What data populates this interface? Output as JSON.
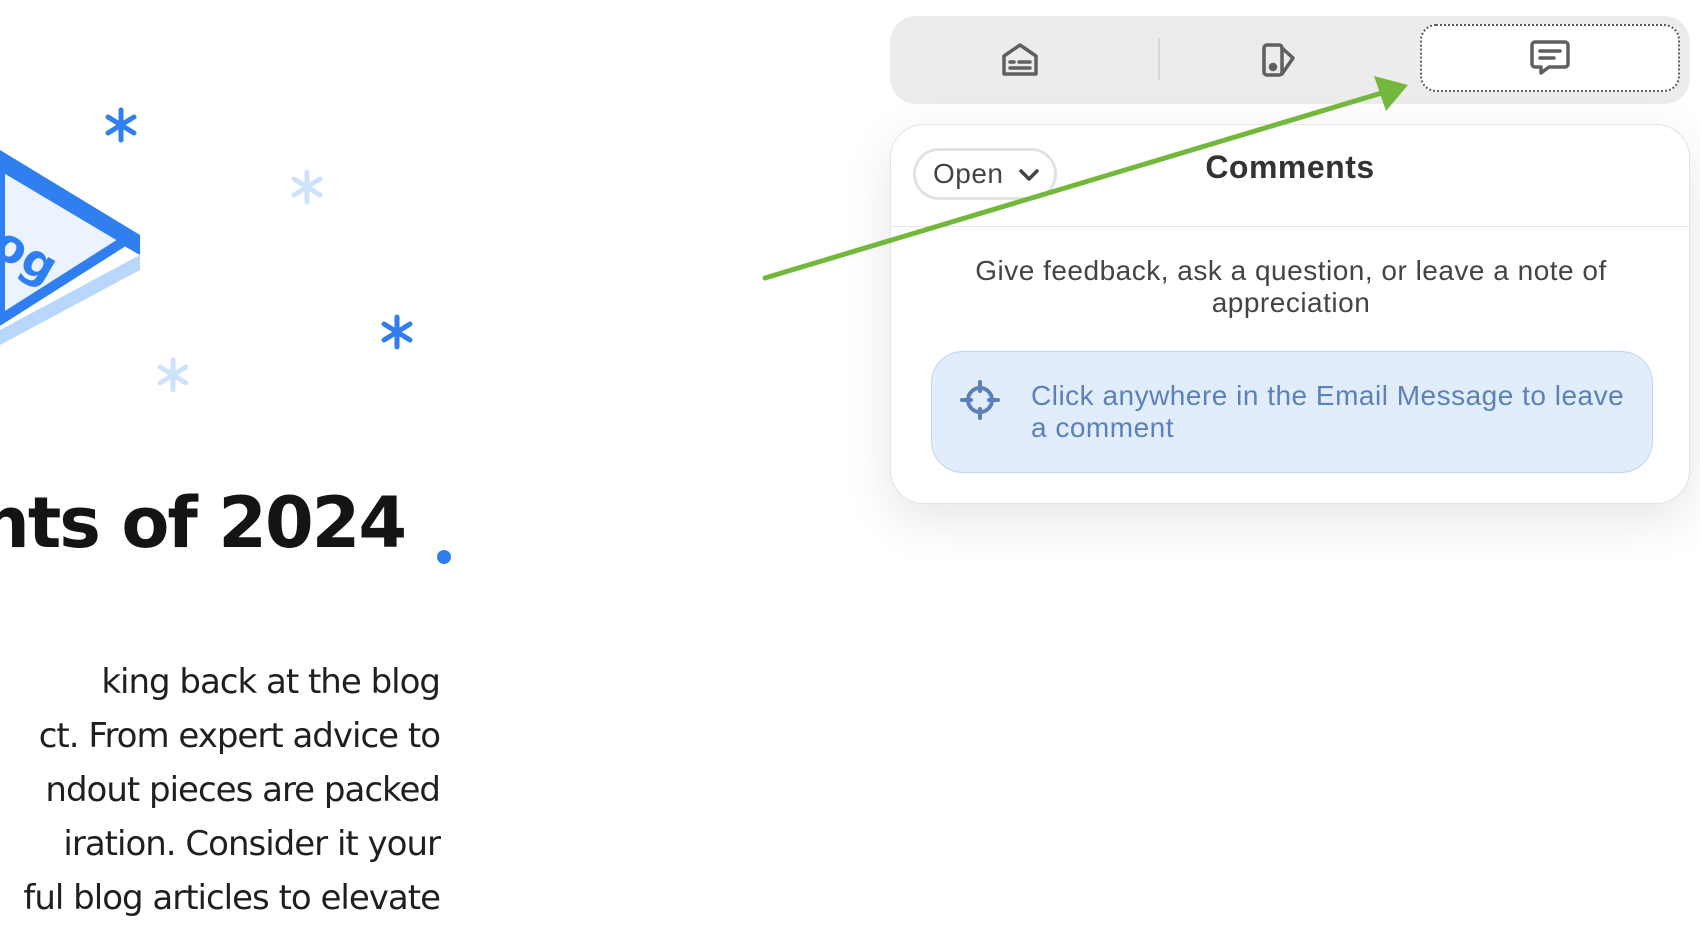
{
  "email": {
    "headline": "hts of 2024",
    "illustration_text": "og",
    "body_lines": [
      "king back at the blog",
      "ct. From expert advice to",
      "ndout pieces are packed",
      "iration. Consider it your",
      "ful blog articles to elevate"
    ]
  },
  "tabs": [
    {
      "icon": "envelope-info-icon",
      "selected": false
    },
    {
      "icon": "brush-swatch-icon",
      "selected": false
    },
    {
      "icon": "comment-icon",
      "selected": true
    }
  ],
  "comments_panel": {
    "status_filter": "Open",
    "title": "Comments",
    "hint": "Give feedback, ask a question, or leave a note of appreciation",
    "cta_text": "Click anywhere in the Email Message to leave a comment",
    "cta_icon": "crosshair-icon"
  },
  "colors": {
    "accent_blue": "#2f7ff0",
    "arrow_green": "#73b83c",
    "cta_background": "#e1edfb",
    "cta_text": "#5c80b8"
  }
}
